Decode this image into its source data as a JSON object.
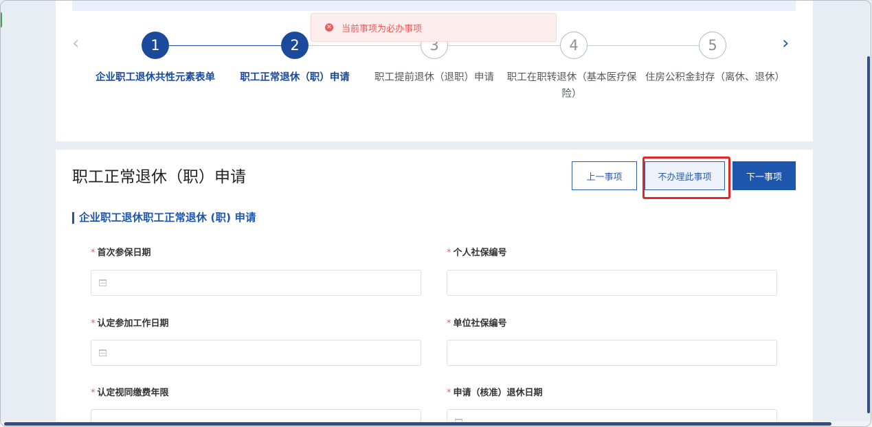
{
  "stepper": {
    "steps": [
      {
        "number": "1",
        "label": "企业职工退休共性元素表单",
        "state": "done"
      },
      {
        "number": "2",
        "label": "职工正常退休（职）申请",
        "state": "active"
      },
      {
        "number": "3",
        "label": "职工提前退休（退职）申请",
        "state": "todo"
      },
      {
        "number": "4",
        "label": "职工在职转退休（基本医疗保险）",
        "state": "todo"
      },
      {
        "number": "5",
        "label": "住房公积金封存（离休、退休）",
        "state": "todo"
      }
    ]
  },
  "toast": {
    "message": "当前事项为必办事项"
  },
  "main": {
    "title": "职工正常退休（职）申请",
    "buttons": {
      "prev": "上一事项",
      "skip": "不办理此事项",
      "next": "下一事项"
    },
    "section_title": "企业职工退休职工正常退休 (职) 申请",
    "required_mark": "*",
    "fields": [
      {
        "label": "首次参保日期",
        "value": "",
        "type": "date"
      },
      {
        "label": "个人社保编号",
        "value": "",
        "type": "text"
      },
      {
        "label": "认定参加工作日期",
        "value": "",
        "type": "date"
      },
      {
        "label": "单位社保编号",
        "value": "",
        "type": "text"
      },
      {
        "label": "认定视同缴费年限",
        "value": "",
        "type": "text"
      },
      {
        "label": "申请（核准）退休日期",
        "value": "",
        "type": "date"
      }
    ]
  },
  "colors": {
    "primary": "#1b4a9c",
    "error": "#f05a5a",
    "highlight": "#e42525"
  }
}
